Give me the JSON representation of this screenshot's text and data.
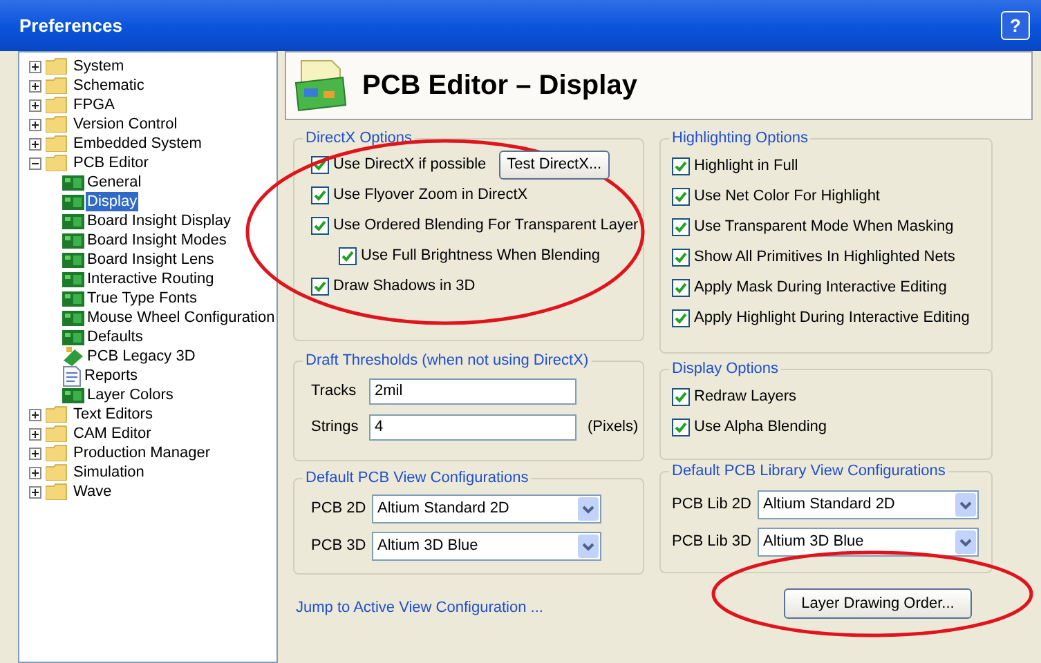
{
  "window": {
    "title": "Preferences",
    "help": "?"
  },
  "tree": [
    {
      "label": "System",
      "kind": "folder",
      "expanded": false,
      "selected": false
    },
    {
      "label": "Schematic",
      "kind": "folder",
      "expanded": false,
      "selected": false
    },
    {
      "label": "FPGA",
      "kind": "folder",
      "expanded": false,
      "selected": false
    },
    {
      "label": "Version Control",
      "kind": "folder",
      "expanded": false,
      "selected": false
    },
    {
      "label": "Embedded System",
      "kind": "folder",
      "expanded": false,
      "selected": false
    },
    {
      "label": "PCB Editor",
      "kind": "folder",
      "expanded": true,
      "selected": false,
      "children": [
        {
          "label": "General",
          "kind": "page",
          "selected": false
        },
        {
          "label": "Display",
          "kind": "page",
          "selected": true
        },
        {
          "label": "Board Insight Display",
          "kind": "page",
          "selected": false
        },
        {
          "label": "Board Insight Modes",
          "kind": "page",
          "selected": false
        },
        {
          "label": "Board Insight Lens",
          "kind": "page",
          "selected": false
        },
        {
          "label": "Interactive Routing",
          "kind": "page",
          "selected": false
        },
        {
          "label": "True Type Fonts",
          "kind": "page",
          "selected": false
        },
        {
          "label": "Mouse Wheel Configuration",
          "kind": "page",
          "selected": false
        },
        {
          "label": "Defaults",
          "kind": "page",
          "selected": false
        },
        {
          "label": "PCB Legacy 3D",
          "kind": "legacy",
          "selected": false
        },
        {
          "label": "Reports",
          "kind": "report",
          "selected": false
        },
        {
          "label": "Layer Colors",
          "kind": "page",
          "selected": false
        }
      ]
    },
    {
      "label": "Text Editors",
      "kind": "folder",
      "expanded": false,
      "selected": false
    },
    {
      "label": "CAM Editor",
      "kind": "folder",
      "expanded": false,
      "selected": false
    },
    {
      "label": "Production Manager",
      "kind": "folder",
      "expanded": false,
      "selected": false
    },
    {
      "label": "Simulation",
      "kind": "folder",
      "expanded": false,
      "selected": false
    },
    {
      "label": "Wave",
      "kind": "folder",
      "expanded": false,
      "selected": false
    }
  ],
  "header": {
    "title": "PCB Editor – Display"
  },
  "directx": {
    "title": "DirectX Options",
    "options": [
      {
        "label": "Use DirectX if possible",
        "checked": true,
        "indented": false,
        "button": "Test DirectX..."
      },
      {
        "label": "Use Flyover Zoom in DirectX",
        "checked": true,
        "indented": false
      },
      {
        "label": "Use Ordered Blending For Transparent Layer",
        "checked": true,
        "indented": false
      },
      {
        "label": "Use Full Brightness When Blending",
        "checked": true,
        "indented": true
      },
      {
        "label": "Draw Shadows in 3D",
        "checked": true,
        "indented": false
      }
    ]
  },
  "highlighting": {
    "title": "Highlighting Options",
    "options": [
      {
        "label": "Highlight in Full",
        "checked": true
      },
      {
        "label": "Use Net Color For Highlight",
        "checked": true
      },
      {
        "label": "Use Transparent Mode When Masking",
        "checked": true
      },
      {
        "label": "Show All Primitives In Highlighted Nets",
        "checked": true
      },
      {
        "label": "Apply Mask During Interactive Editing",
        "checked": true
      },
      {
        "label": "Apply Highlight During Interactive Editing",
        "checked": true
      }
    ]
  },
  "draft": {
    "title": "Draft Thresholds (when not using DirectX)",
    "fields": [
      {
        "label": "Tracks",
        "value": "2mil"
      },
      {
        "label": "Strings",
        "value": "4",
        "unit": "(Pixels)"
      }
    ]
  },
  "display": {
    "title": "Display Options",
    "options": [
      {
        "label": "Redraw Layers",
        "checked": true
      },
      {
        "label": "Use Alpha Blending",
        "checked": true
      }
    ]
  },
  "pcb_view": {
    "title": "Default PCB View Configurations",
    "selects": [
      {
        "label": "PCB 2D",
        "value": "Altium Standard 2D"
      },
      {
        "label": "PCB 3D",
        "value": "Altium 3D Blue"
      }
    ]
  },
  "lib_view": {
    "title": "Default PCB Library View Configurations",
    "selects": [
      {
        "label": "PCB Lib 2D",
        "value": "Altium Standard 2D"
      },
      {
        "label": "PCB Lib 3D",
        "value": "Altium 3D Blue"
      }
    ]
  },
  "jump_link": "Jump to Active View Configuration ...",
  "layer_button": "Layer Drawing Order..."
}
